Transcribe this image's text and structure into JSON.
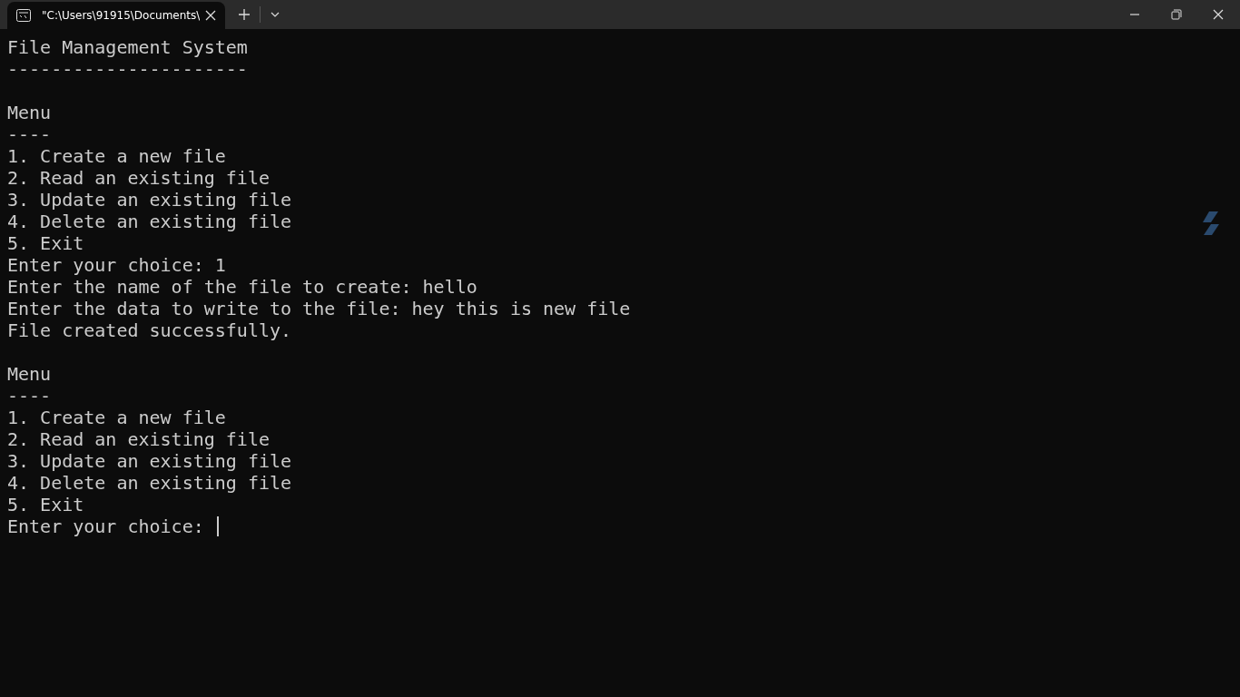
{
  "tab": {
    "title": "\"C:\\Users\\91915\\Documents\\",
    "selected": true
  },
  "lines": [
    {
      "kind": "text",
      "text": "File Management System"
    },
    {
      "kind": "text",
      "text": "----------------------"
    },
    {
      "kind": "blank"
    },
    {
      "kind": "text",
      "text": "Menu"
    },
    {
      "kind": "text",
      "text": "----"
    },
    {
      "kind": "text",
      "text": "1. Create a new file"
    },
    {
      "kind": "text",
      "text": "2. Read an existing file"
    },
    {
      "kind": "text",
      "text": "3. Update an existing file"
    },
    {
      "kind": "text",
      "text": "4. Delete an existing file"
    },
    {
      "kind": "text",
      "text": "5. Exit"
    },
    {
      "kind": "text",
      "text": "Enter your choice: 1"
    },
    {
      "kind": "text",
      "text": "Enter the name of the file to create: hello"
    },
    {
      "kind": "text",
      "text": "Enter the data to write to the file: hey this is new file"
    },
    {
      "kind": "text",
      "text": "File created successfully."
    },
    {
      "kind": "blank"
    },
    {
      "kind": "text",
      "text": "Menu"
    },
    {
      "kind": "text",
      "text": "----"
    },
    {
      "kind": "text",
      "text": "1. Create a new file"
    },
    {
      "kind": "text",
      "text": "2. Read an existing file"
    },
    {
      "kind": "text",
      "text": "3. Update an existing file"
    },
    {
      "kind": "text",
      "text": "4. Delete an existing file"
    },
    {
      "kind": "text",
      "text": "5. Exit"
    },
    {
      "kind": "prompt",
      "text": "Enter your choice:"
    }
  ]
}
